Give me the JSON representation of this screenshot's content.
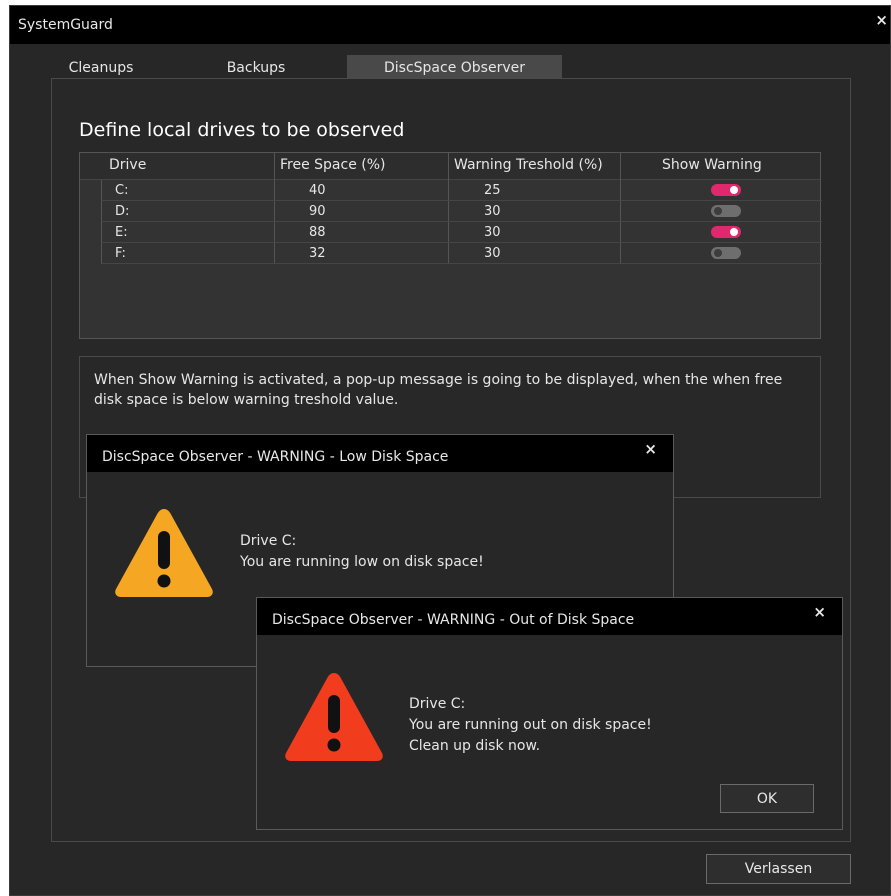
{
  "window": {
    "title": "SystemGuard",
    "close": "×"
  },
  "tabs": [
    {
      "label": "Cleanups"
    },
    {
      "label": "Backups"
    },
    {
      "label": "DiscSpace Observer",
      "active": true
    }
  ],
  "panel": {
    "heading": "Define local drives to be observed"
  },
  "table": {
    "headers": {
      "drive": "Drive",
      "free": "Free Space (%)",
      "warning": "Warning Treshold (%)",
      "show": "Show Warning"
    },
    "rows": [
      {
        "drive": "C:",
        "free": "40",
        "warning": "25",
        "show": true
      },
      {
        "drive": "D:",
        "free": "90",
        "warning": "30",
        "show": false
      },
      {
        "drive": "E:",
        "free": "88",
        "warning": "30",
        "show": true
      },
      {
        "drive": "F:",
        "free": "32",
        "warning": "30",
        "show": false
      }
    ]
  },
  "info": {
    "text": "When Show Warning is activated, a pop-up message is going to be displayed, when the when free disk space is below warning treshold value."
  },
  "dialog_low": {
    "title": "DiscSpace Observer - WARNING - Low Disk Space",
    "close": "×",
    "line1": "Drive C:",
    "line2": "You are running low on disk space!",
    "icon_color": "#f5a623"
  },
  "dialog_out": {
    "title": "DiscSpace Observer - WARNING - Out of Disk Space",
    "close": "×",
    "line1": "Drive C:",
    "line2": "You are running out on disk space!",
    "line3": "Clean up disk now.",
    "ok_label": "OK",
    "icon_color": "#f23c1e"
  },
  "footer": {
    "exit_label": "Verlassen"
  },
  "colors": {
    "toggle_on": "#e0286f",
    "toggle_off": "#6e6e6e",
    "background": "#272727",
    "titlebar": "#000000"
  }
}
